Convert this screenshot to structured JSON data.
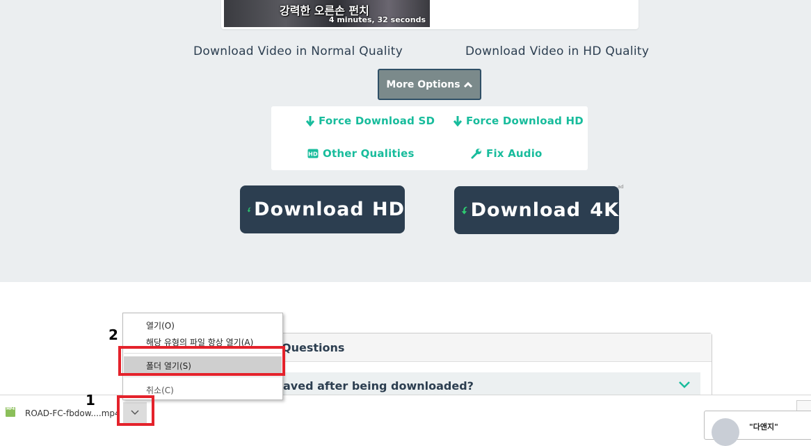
{
  "video": {
    "thumbnail_title": "강력한 오른손 펀치",
    "duration": "4 minutes, 32 seconds"
  },
  "links": {
    "normal_quality": "Download Video in Normal Quality",
    "hd_quality": "Download Video in HD Quality"
  },
  "more_options": {
    "label": "More Options"
  },
  "options": {
    "force_sd": "Force Download SD",
    "force_hd": "Force Download HD",
    "other_qualities": "Other Qualities",
    "fix_audio": "Fix Audio"
  },
  "ads": {
    "download_hd": {
      "word": "Download",
      "quality": "HD"
    },
    "download_4k": {
      "word": "Download",
      "quality": "4K"
    },
    "ad_label": "ad"
  },
  "faq": {
    "heading": "Questions",
    "question": "aved after being downloaded?"
  },
  "context_menu": {
    "items": [
      "열기(O)",
      "해당 유형의 파일 항상 열기(A)",
      "폴더 열기(S)",
      "취소(C)"
    ]
  },
  "annotations": {
    "label1": "1",
    "label2": "2"
  },
  "download_bar": {
    "file_name": "ROAD-FC-fbdow....mp4",
    "file_icon_text": "MP4"
  },
  "side_card": {
    "text": "\"다앤지\""
  },
  "colors": {
    "accent": "#18bc9c",
    "dark": "#2c3e50",
    "highlight_red": "#e4222b",
    "button_gray": "#7b8a8b"
  }
}
